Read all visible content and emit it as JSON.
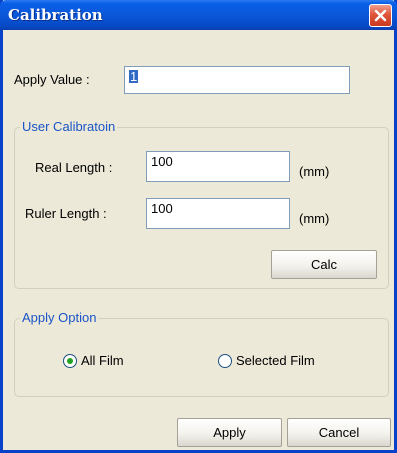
{
  "window": {
    "title": "Calibration"
  },
  "apply_value": {
    "label": "Apply Value :",
    "value": "1"
  },
  "user_calibration": {
    "group_label": "User Calibratoin",
    "real_length": {
      "label": "Real Length :",
      "value": "100",
      "unit": "(mm)"
    },
    "ruler_length": {
      "label": "Ruler Length :",
      "value": "100",
      "unit": "(mm)"
    },
    "calc_label": "Calc"
  },
  "apply_option": {
    "group_label": "Apply Option",
    "options": [
      {
        "label": "All Film",
        "selected": true
      },
      {
        "label": "Selected Film",
        "selected": false
      }
    ]
  },
  "buttons": {
    "apply": "Apply",
    "cancel": "Cancel"
  },
  "colors": {
    "title_bar": "#0a56d8",
    "close_button": "#e0553a",
    "group_label": "#1a54c8",
    "dialog_bg": "#ece9d8"
  },
  "icons": {
    "close": "close-icon"
  }
}
